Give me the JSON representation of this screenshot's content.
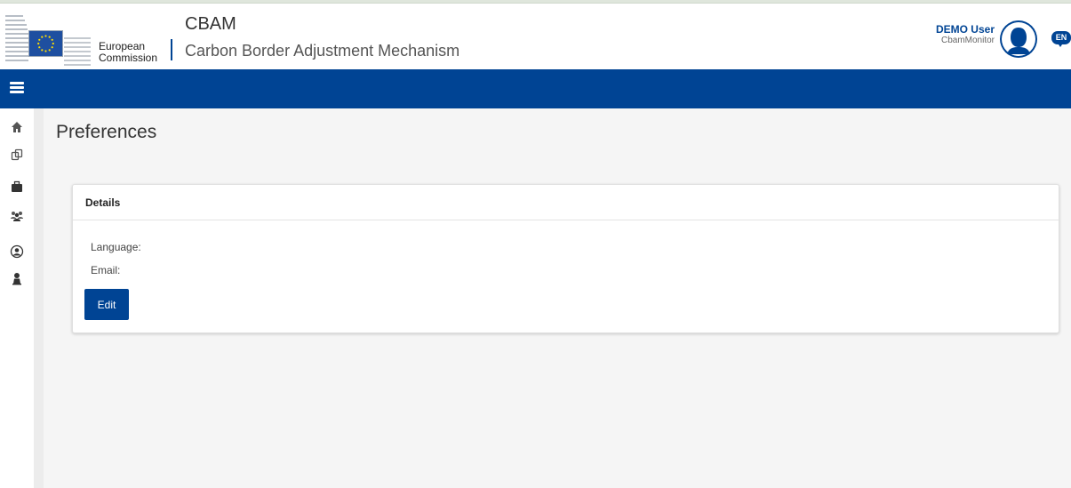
{
  "header": {
    "org_line1": "European",
    "org_line2": "Commission",
    "app_title": "CBAM",
    "app_subtitle": "Carbon Border Adjustment Mechanism"
  },
  "user": {
    "name": "DEMO User",
    "role": "CbamMonitor",
    "language": "EN"
  },
  "icons": {
    "menu": "hamburger-icon",
    "sidebar": [
      "home-icon",
      "copy-icon",
      "briefcase-icon",
      "users-icon",
      "user-circle-icon",
      "user-icon"
    ],
    "language": "speech-bubble-icon"
  },
  "page": {
    "title": "Preferences"
  },
  "details": {
    "title": "Details",
    "language_label": "Language:",
    "email_label": "Email:",
    "edit_label": "Edit"
  },
  "colors": {
    "primary": "#004494",
    "background": "#f5f5f5",
    "card": "#ffffff"
  }
}
